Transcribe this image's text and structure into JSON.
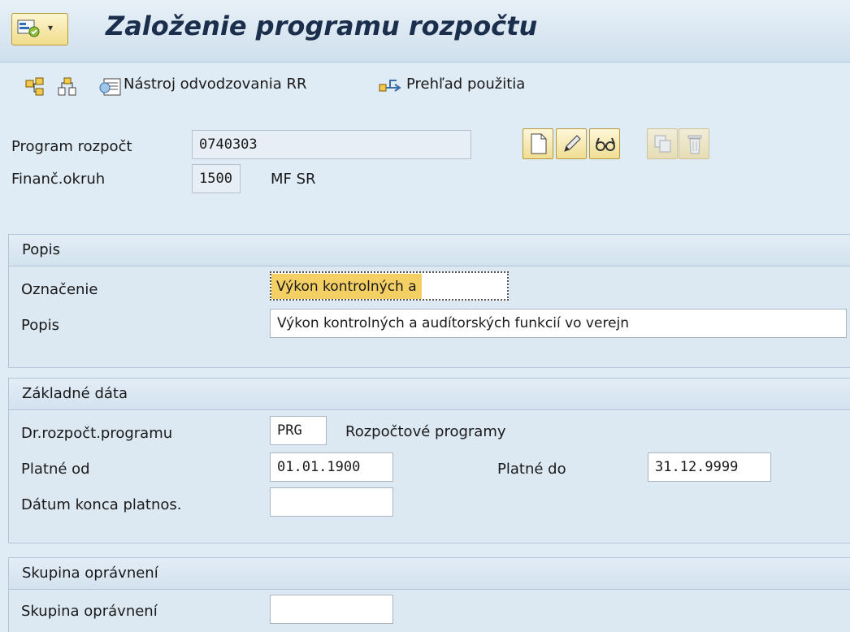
{
  "header": {
    "title": "Založenie programu rozpočtu"
  },
  "toolbar": {
    "icons": [
      "hierarchy-icon",
      "structure-icon",
      "derivation-tool-icon",
      "usage-overview-icon"
    ],
    "derivation_label": "Nástroj odvodzovania RR",
    "usage_label": "Prehľad použitia"
  },
  "form": {
    "program_label": "Program rozpočt",
    "program_value": "0740303",
    "fin_area_label": "Finanč.okruh",
    "fin_area_value": "1500",
    "fin_area_text": "MF SR"
  },
  "actions": [
    "create-icon",
    "change-icon",
    "display-icon",
    "copy-icon",
    "delete-icon"
  ],
  "popis_group": {
    "title": "Popis",
    "oznacenie_label": "Označenie",
    "oznacenie_value": "Výkon kontrolných a",
    "popis_label": "Popis",
    "popis_value": "Výkon kontrolných a audítorských funkcií vo verejn"
  },
  "basic_group": {
    "title": "Základné dáta",
    "type_label": "Dr.rozpočt.programu",
    "type_value": "PRG",
    "type_text": "Rozpočtové programy",
    "valid_from_label": "Platné od",
    "valid_from_value": "01.01.1900",
    "valid_to_label": "Platné do",
    "valid_to_value": "31.12.9999",
    "end_date_label": "Dátum konca platnos.",
    "end_date_value": ""
  },
  "auth_group": {
    "title": "Skupina oprávnení",
    "auth_label": "Skupina oprávnení",
    "auth_value": ""
  }
}
